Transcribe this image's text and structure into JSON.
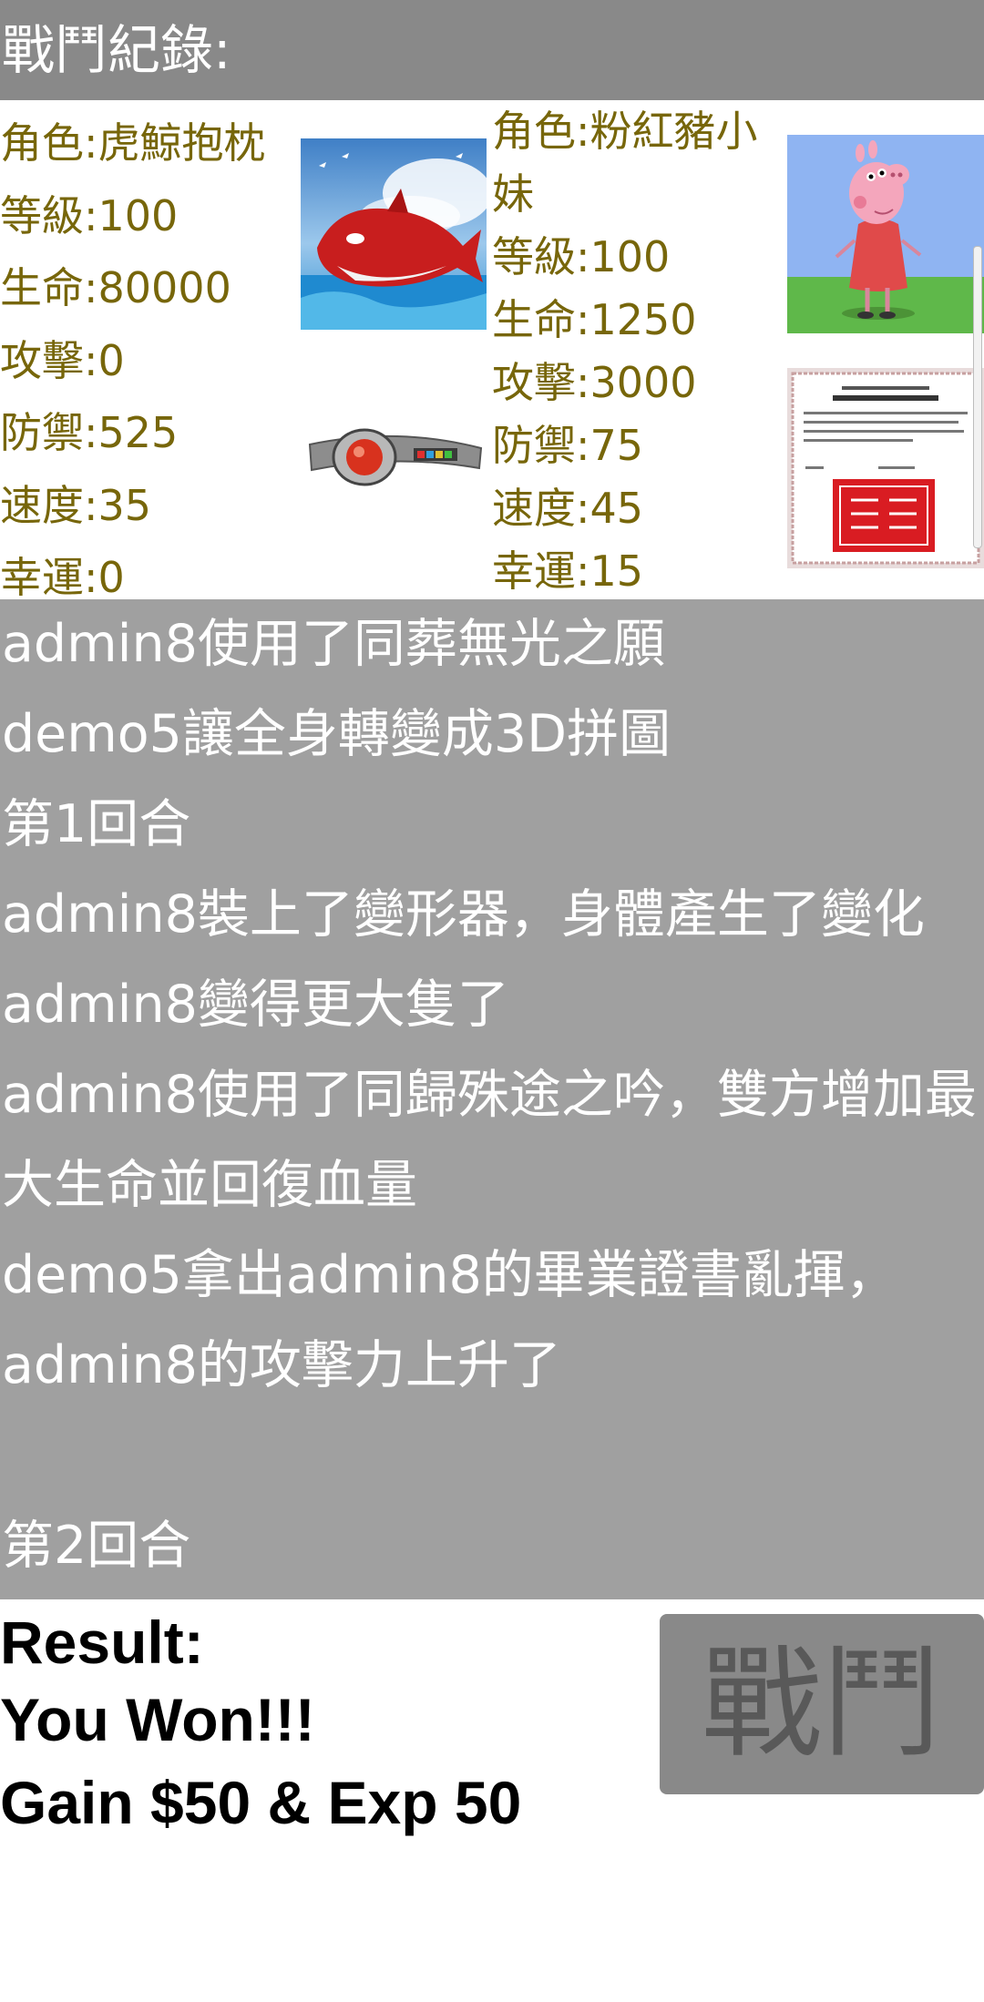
{
  "header": {
    "title": "戰鬥紀錄:"
  },
  "player1": {
    "role": "角色:虎鯨抱枕",
    "level": "等級:100",
    "hp": "生命:80000",
    "attack": "攻擊:0",
    "defense": "防禦:525",
    "speed": "速度:35",
    "luck": "幸運:0"
  },
  "player2": {
    "role": "角色:粉紅豬小妹",
    "level": "等級:100",
    "hp": "生命:1250",
    "attack": "攻擊:3000",
    "defense": "防禦:75",
    "speed": "速度:45",
    "luck": "幸運:15"
  },
  "battle_log": [
    "admin8使用了同葬無光之願",
    "demo5讓全身轉變成3D拼圖",
    "第1回合",
    "admin8裝上了變形器，身體產生了變化",
    "admin8變得更大隻了",
    "admin8使用了同歸殊途之吟，雙方增加最大生命並回復血量",
    "demo5拿出admin8的畢業證書亂揮，admin8的攻擊力上升了",
    "",
    "第2回合"
  ],
  "result": {
    "label": "Result:",
    "outcome": "You Won!!!",
    "reward": "Gain $50 & Exp 50"
  },
  "fight_button": {
    "label": "戰鬥"
  },
  "colors": {
    "header_bg": "#898989",
    "stat_text": "#77660a",
    "log_bg": "#a0a0a0",
    "button_bg": "#898989",
    "button_text": "#595959"
  },
  "icons": [
    "orca-plush-image",
    "transformer-belt-image",
    "peppa-pig-image",
    "diploma-certificate-image"
  ]
}
